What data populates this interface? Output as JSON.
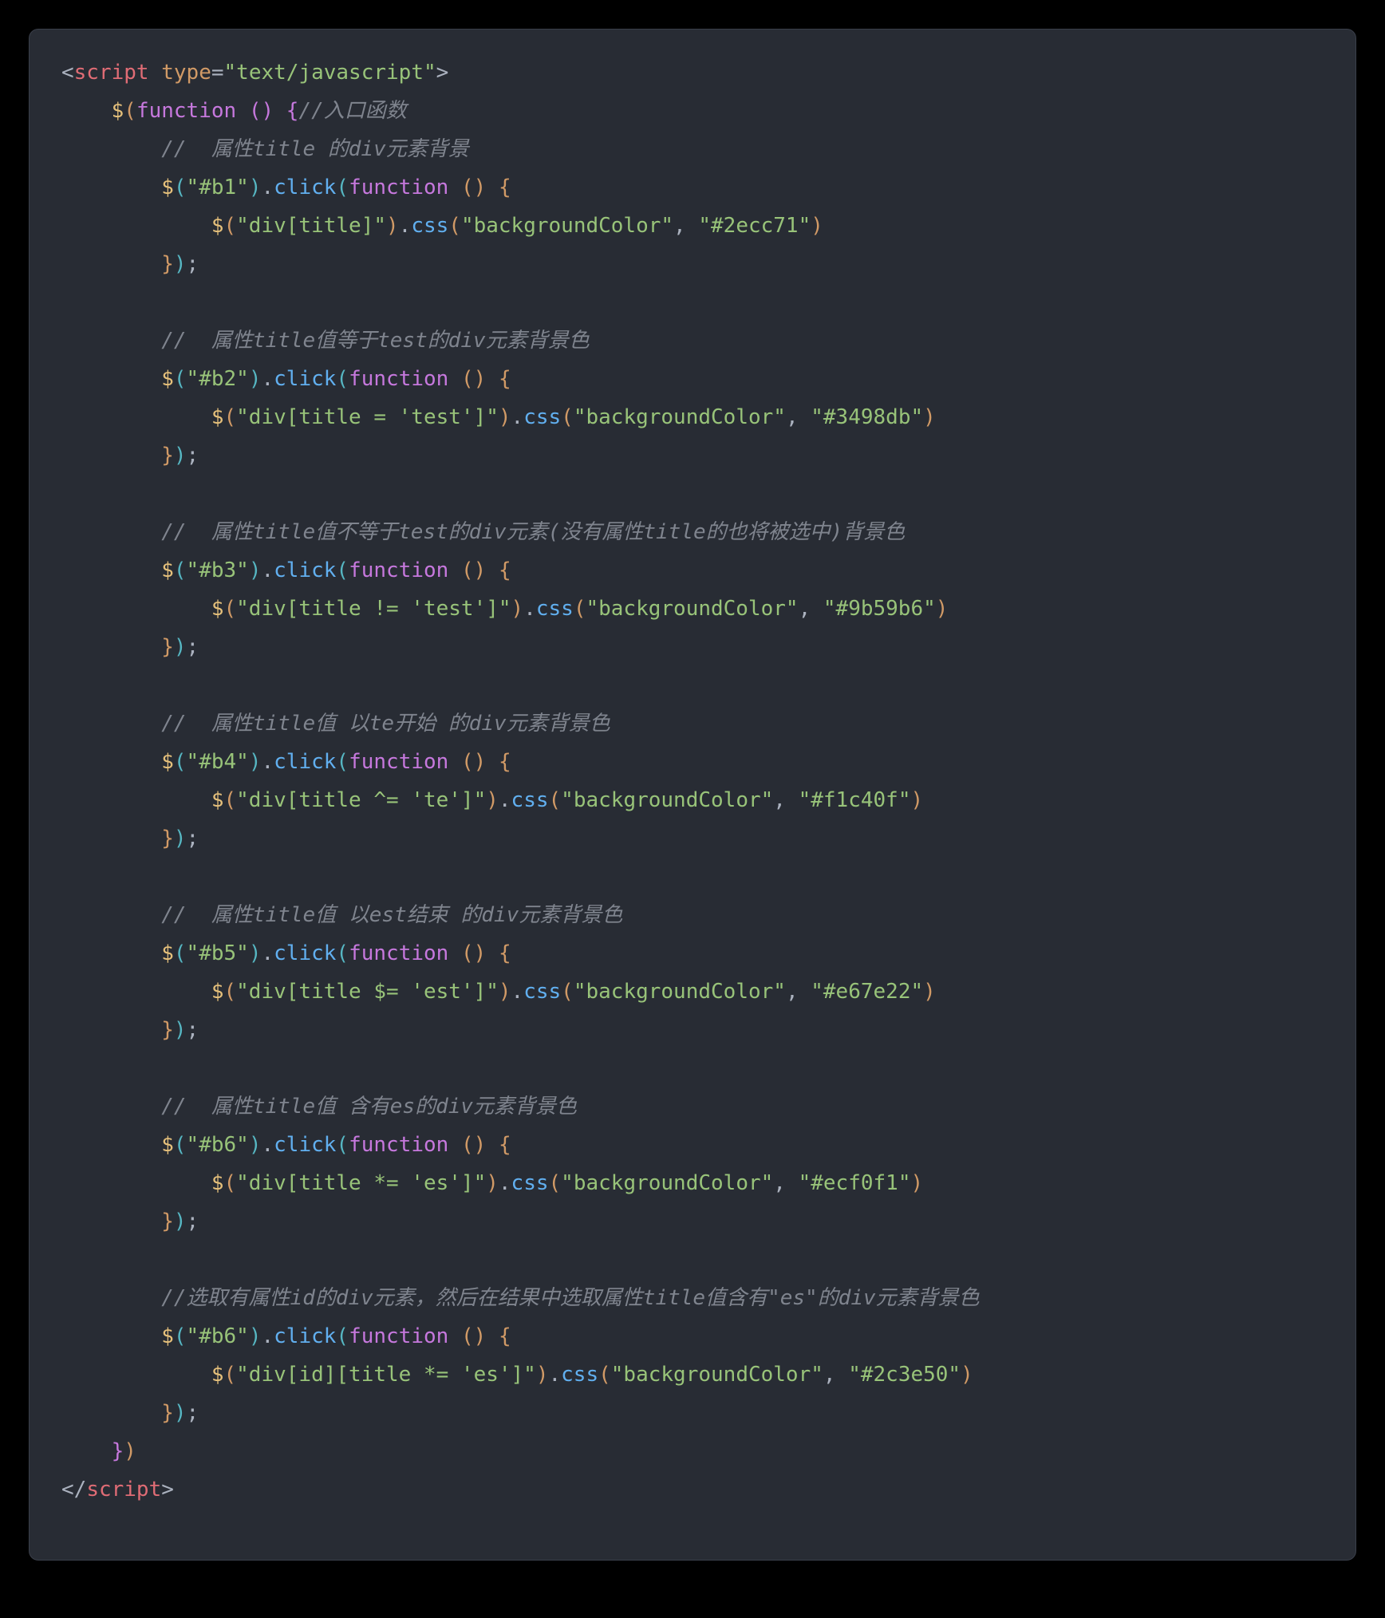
{
  "code": {
    "open_tag": {
      "lt": "<",
      "name": "script",
      "attr": "type",
      "eq": "=",
      "val": "\"text/javascript\"",
      "gt": ">"
    },
    "entry": {
      "dollar": "$",
      "p1": "(",
      "kw": "function",
      "sp": " ",
      "p2": "(",
      "p3": ")",
      "sp2": " ",
      "b1": "{",
      "comment": "//入口函数"
    },
    "blocks": [
      {
        "comment": "//  属性title 的div元素背景",
        "sel": "\"#b1\"",
        "method": "click",
        "kw": "function",
        "inner_sel": "\"div[title]\"",
        "css": "css",
        "prop": "\"backgroundColor\"",
        "color": "\"#2ecc71\""
      },
      {
        "comment": "//  属性title值等于test的div元素背景色",
        "sel": "\"#b2\"",
        "method": "click",
        "kw": "function",
        "inner_sel": "\"div[title = 'test']\"",
        "css": "css",
        "prop": "\"backgroundColor\"",
        "color": "\"#3498db\""
      },
      {
        "comment": "//  属性title值不等于test的div元素(没有属性title的也将被选中)背景色",
        "sel": "\"#b3\"",
        "method": "click",
        "kw": "function",
        "inner_sel": "\"div[title != 'test']\"",
        "css": "css",
        "prop": "\"backgroundColor\"",
        "color": "\"#9b59b6\""
      },
      {
        "comment": "//  属性title值 以te开始 的div元素背景色",
        "sel": "\"#b4\"",
        "method": "click",
        "kw": "function",
        "inner_sel": "\"div[title ^= 'te']\"",
        "css": "css",
        "prop": "\"backgroundColor\"",
        "color": "\"#f1c40f\""
      },
      {
        "comment": "//  属性title值 以est结束 的div元素背景色",
        "sel": "\"#b5\"",
        "method": "click",
        "kw": "function",
        "inner_sel": "\"div[title $= 'est']\"",
        "css": "css",
        "prop": "\"backgroundColor\"",
        "color": "\"#e67e22\""
      },
      {
        "comment": "//  属性title值 含有es的div元素背景色",
        "sel": "\"#b6\"",
        "method": "click",
        "kw": "function",
        "inner_sel": "\"div[title *= 'es']\"",
        "css": "css",
        "prop": "\"backgroundColor\"",
        "color": "\"#ecf0f1\""
      },
      {
        "comment": "//选取有属性id的div元素，然后在结果中选取属性title值含有\"es\"的div元素背景色",
        "sel": "\"#b6\"",
        "method": "click",
        "kw": "function",
        "inner_sel": "\"div[id][title *= 'es']\"",
        "css": "css",
        "prop": "\"backgroundColor\"",
        "color": "\"#2c3e50\""
      }
    ],
    "entry_close": {
      "b": "}",
      "p": ")"
    },
    "close_tag": {
      "lt": "</",
      "name": "script",
      "gt": ">"
    }
  }
}
